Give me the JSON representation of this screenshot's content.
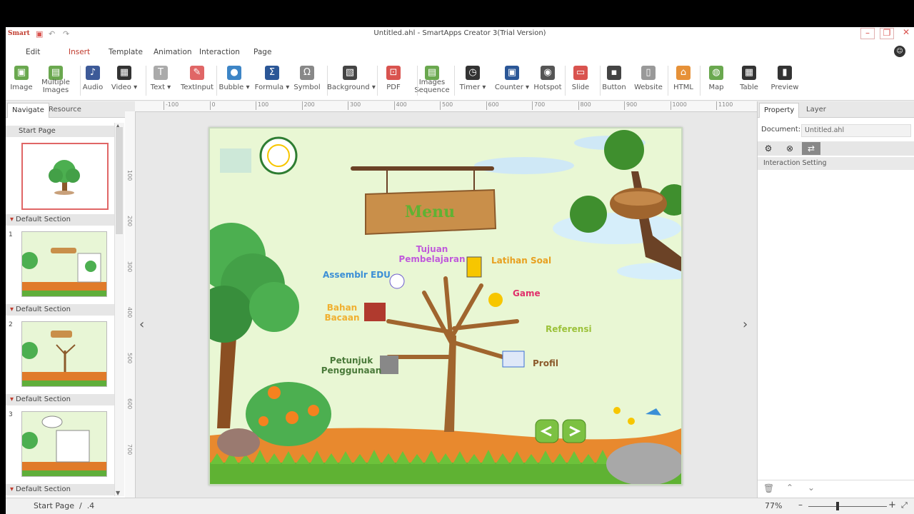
{
  "app": {
    "logo": "Smart",
    "title": "Untitled.ahl - SmartApps Creator 3(Trial Version)"
  },
  "menus": [
    "Edit",
    "Insert",
    "Template",
    "Animation",
    "Interaction",
    "Page"
  ],
  "active_menu": "Insert",
  "toolbar": [
    {
      "label": "Image",
      "icon": "image-icon",
      "color": "#6aa84f"
    },
    {
      "label": "Multiple\nImages",
      "icon": "multiple-images-icon",
      "color": "#6aa84f"
    },
    {
      "label": "Audio",
      "icon": "music-note-icon",
      "color": "#3d5a98"
    },
    {
      "label": "Video ▾",
      "icon": "film-icon",
      "color": "#333333"
    },
    {
      "label": "Text ▾",
      "icon": "text-icon",
      "color": "#aaaaaa"
    },
    {
      "label": "TextInput",
      "icon": "text-input-icon",
      "color": "#e06666"
    },
    {
      "label": "Bubble ▾",
      "icon": "speech-bubble-icon",
      "color": "#3d85c6"
    },
    {
      "label": "Formula ▾",
      "icon": "sigma-icon",
      "color": "#2b5797"
    },
    {
      "label": "Symbol",
      "icon": "omega-icon",
      "color": "#888888"
    },
    {
      "label": "Background ▾",
      "icon": "background-icon",
      "color": "#444444"
    },
    {
      "label": "PDF",
      "icon": "pdf-icon",
      "color": "#d9534f"
    },
    {
      "label": "Images\nSequence",
      "icon": "images-sequence-icon",
      "color": "#6aa84f"
    },
    {
      "label": "Timer ▾",
      "icon": "stopwatch-icon",
      "color": "#333333"
    },
    {
      "label": "Counter ▾",
      "icon": "counter-icon",
      "color": "#2b5797"
    },
    {
      "label": "Hotspot",
      "icon": "hotspot-icon",
      "color": "#555555"
    },
    {
      "label": "Slide",
      "icon": "slide-icon",
      "color": "#d9534f"
    },
    {
      "label": "Button",
      "icon": "button-icon",
      "color": "#444444"
    },
    {
      "label": "Website",
      "icon": "website-icon",
      "color": "#999999"
    },
    {
      "label": "HTML",
      "icon": "html-icon",
      "color": "#e69138"
    },
    {
      "label": "Map",
      "icon": "map-icon",
      "color": "#6aa84f"
    },
    {
      "label": "Table",
      "icon": "table-icon",
      "color": "#333333"
    },
    {
      "label": "Preview",
      "icon": "preview-icon",
      "color": "#333333"
    }
  ],
  "left_panel": {
    "tabs": [
      "Navigate",
      "Resource"
    ],
    "start_page": "Start Page",
    "section_label": "Default Section",
    "pages": [
      "1",
      "2",
      "3"
    ]
  },
  "ruler": {
    "h_ticks": [
      "-100",
      "0",
      "100",
      "200",
      "300",
      "400",
      "500",
      "600",
      "700",
      "800",
      "900",
      "1000",
      "1100"
    ],
    "v_ticks": [
      "100",
      "200",
      "300",
      "400",
      "500",
      "600",
      "700"
    ]
  },
  "page": {
    "menu_title": "Menu",
    "labels": {
      "tujuan": "Tujuan\nPembelajaran",
      "latihan": "Latihan Soal",
      "assemblr": "Assemblr EDU",
      "game": "Game",
      "bahan": "Bahan\nBacaan",
      "referensi": "Referensi",
      "petunjuk": "Petunjuk\nPenggunaan",
      "profil": "Profil"
    }
  },
  "right_panel": {
    "tabs": [
      "Property",
      "Layer"
    ],
    "document_label": "Document:",
    "document_value": "Untitled.ahl",
    "interaction_setting": "Interaction Setting"
  },
  "status": {
    "page_info": "Start Page  /  .4",
    "zoom": "77%"
  }
}
